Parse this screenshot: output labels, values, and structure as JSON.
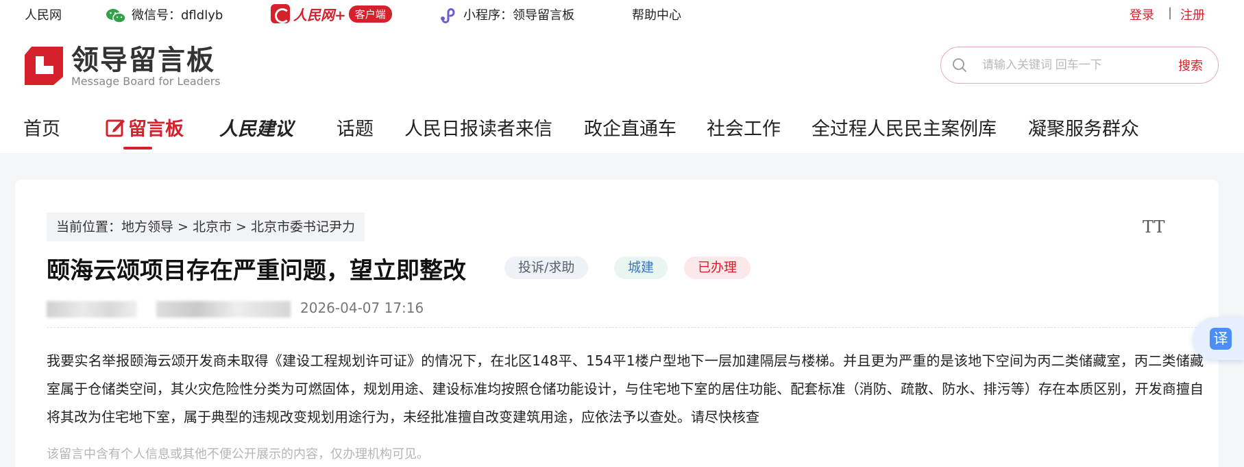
{
  "topbar": {
    "people_net": "人民网",
    "wechat_label": "微信号：dfldlyb",
    "app_brand": "人民网+",
    "app_badge": "客户端",
    "mini_program": "小程序：领导留言板",
    "help": "帮助中心",
    "login": "登录",
    "separator": "|",
    "register": "注册"
  },
  "header": {
    "logo_cn": "领导留言板",
    "logo_en": "Message Board for Leaders",
    "search_placeholder": "请输入关键词 回车一下",
    "search_button": "搜索"
  },
  "nav": {
    "items": [
      "首页",
      "留言板",
      "人民建议",
      "话题",
      "人民日报读者来信",
      "政企直通车",
      "社会工作",
      "全过程人民民主案例库",
      "凝聚服务群众"
    ],
    "active_index": 1
  },
  "article": {
    "breadcrumb": "当前位置：地方领导 > 北京市 > 北京市委书记尹力",
    "title": "颐海云颂项目存在严重问题，望立即整改",
    "tags": [
      "投诉/求助",
      "城建",
      "已办理"
    ],
    "date": "2026-04-07 17:16",
    "content": "我要实名举报颐海云颂开发商未取得《建设工程规划许可证》的情况下，在北区148平、154平1楼户型地下一层加建隔层与楼梯。并且更为严重的是该地下空间为丙二类储藏室，丙二类储藏室属于仓储类空间，其火灾危险性分类为可燃固体，规划用途、建设标准均按照仓储功能设计，与住宅地下室的居住功能、配套标准（消防、疏散、防水、排污等）存在本质区别，开发商擅自将其改为住宅地下室，属于典型的违规改变规划用途行为，未经批准擅自改变建筑用途，应依法予以查处。请尽快核查",
    "notice": "该留言中含有个人信息或其他不便公开展示的内容，仅办理机构可见。"
  },
  "widgets": {
    "font_size_glyph": "TT",
    "translate": "译"
  },
  "colors": {
    "brand_red": "#d5212b",
    "tag_blue": "#3877c8"
  }
}
